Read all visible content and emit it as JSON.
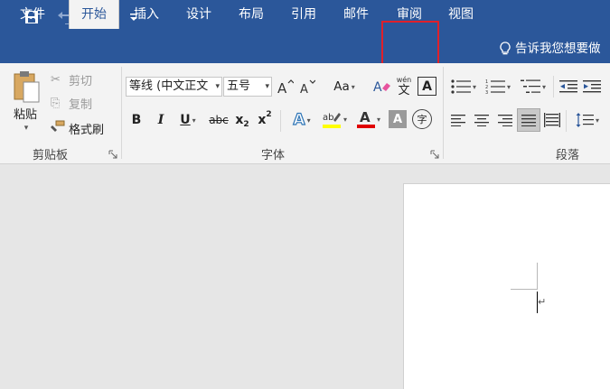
{
  "quick_access": {
    "save_icon": "save-icon",
    "undo_icon": "undo-icon",
    "redo_icon": "redo-icon",
    "customize_icon": "customize-qat-icon"
  },
  "tabs": [
    {
      "label": "文件"
    },
    {
      "label": "开始"
    },
    {
      "label": "插入"
    },
    {
      "label": "设计"
    },
    {
      "label": "布局"
    },
    {
      "label": "引用"
    },
    {
      "label": "邮件"
    },
    {
      "label": "审阅"
    },
    {
      "label": "视图"
    }
  ],
  "active_tab": "开始",
  "highlighted_tab": "审阅",
  "tell_me": "告诉我您想要做",
  "clipboard": {
    "paste": "粘贴",
    "cut": "剪切",
    "copy": "复制",
    "format_painter": "格式刷",
    "group_label": "剪贴板"
  },
  "font": {
    "font_name": "等线 (中文正文",
    "font_size": "五号",
    "change_case": "Aa",
    "phonetic_top": "wén",
    "phonetic_char": "文",
    "char_border": "A",
    "bold": "B",
    "italic": "I",
    "underline": "U",
    "strikethrough": "abc",
    "subscript": "x",
    "subscript_mark": "2",
    "superscript": "x",
    "superscript_mark": "2",
    "text_effects": "A",
    "font_color": "A",
    "char_shading": "A",
    "enclose_char": "字",
    "group_label": "字体"
  },
  "paragraph": {
    "group_label": "段落"
  },
  "colors": {
    "accent": "#2b579a",
    "highlight_box": "#e0202a",
    "highlight_yellow": "#ffff00",
    "font_red": "#e00000"
  }
}
